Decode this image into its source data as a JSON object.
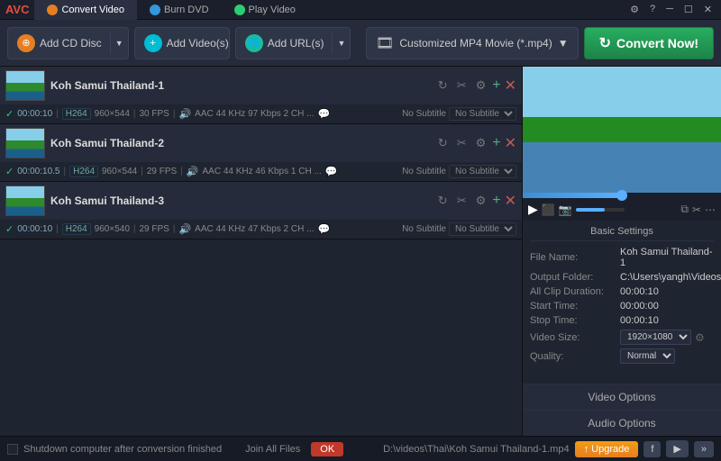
{
  "titleBar": {
    "logo": "AVC",
    "tabs": [
      {
        "id": "convert",
        "label": "Convert Video",
        "iconColor": "orange",
        "active": true
      },
      {
        "id": "burn",
        "label": "Burn DVD",
        "iconColor": "blue",
        "active": false
      },
      {
        "id": "play",
        "label": "Play Video",
        "iconColor": "green",
        "active": false
      }
    ],
    "controls": [
      "⚙",
      "?",
      "─",
      "☐",
      "✕"
    ]
  },
  "toolbar": {
    "addCdDisc": "Add CD Disc",
    "addVideos": "Add Video(s)",
    "addUrl": "Add URL(s)",
    "formatLabel": "Customized MP4 Movie (*.mp4)",
    "convertNow": "Convert Now!"
  },
  "videos": [
    {
      "id": 1,
      "name": "Koh Samui Thailand-1",
      "time": "00:00:10",
      "codec": "H264",
      "resolution": "960×544",
      "fps": "30 FPS",
      "audioCodec": "AAC 44 KHz 97 Kbps 2 CH ...",
      "subtitle": "No Subtitle"
    },
    {
      "id": 2,
      "name": "Koh Samui Thailand-2",
      "time": "00:00:10.5",
      "codec": "H264",
      "resolution": "960×544",
      "fps": "29 FPS",
      "audioCodec": "AAC 44 KHz 46 Kbps 1 CH ...",
      "subtitle": "No Subtitle"
    },
    {
      "id": 3,
      "name": "Koh Samui Thailand-3",
      "time": "00:00:10",
      "codec": "H264",
      "resolution": "960×540",
      "fps": "29 FPS",
      "audioCodec": "AAC 44 KHz 47 Kbps 2 CH ...",
      "subtitle": "No Subtitle"
    }
  ],
  "basicSettings": {
    "title": "Basic Settings",
    "fileName": {
      "label": "File Name:",
      "value": "Koh Samui Thailand-1"
    },
    "outputFolder": {
      "label": "Output Folder:",
      "value": "C:\\Users\\yangh\\Videos\\..."
    },
    "allClipDuration": {
      "label": "All Clip Duration:",
      "value": "00:00:10"
    },
    "startTime": {
      "label": "Start Time:",
      "value": "00:00:00"
    },
    "stopTime": {
      "label": "Stop Time:",
      "value": "00:00:10"
    },
    "videoSize": {
      "label": "Video Size:",
      "value": "1920×1080"
    },
    "quality": {
      "label": "Quality:",
      "value": "Normal"
    }
  },
  "panelButtons": {
    "videoOptions": "Video Options",
    "audioOptions": "Audio Options"
  },
  "statusBar": {
    "checkboxLabel": "Shutdown computer after conversion finished",
    "joinAllFiles": "Join All Files",
    "okBtn": "OK"
  },
  "bottomBar": {
    "path": "D:\\videos\\Thai\\Koh Samui Thailand-1.mp4",
    "upgradeBtn": "↑ Upgrade",
    "socialBtns": [
      "f",
      "▶",
      "»"
    ]
  }
}
